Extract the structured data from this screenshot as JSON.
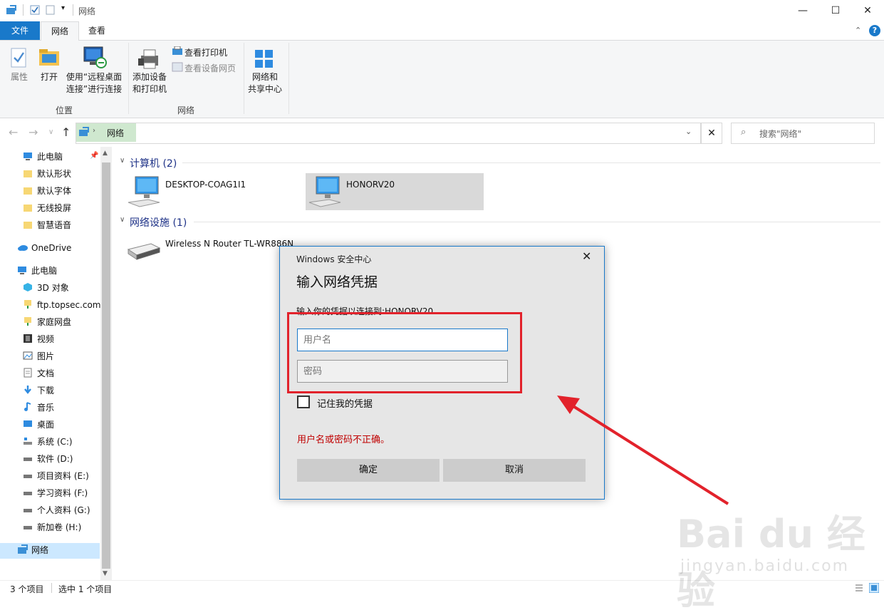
{
  "window": {
    "title": "网络",
    "minimize": "—",
    "maximize": "☐",
    "close": "✕"
  },
  "ribbon_tabs": [
    "文件",
    "网络",
    "查看"
  ],
  "ribbon": {
    "groups": [
      {
        "label": "位置",
        "buttons": [
          "属性",
          "打开",
          "使用“远程桌面\n连接”进行连接"
        ]
      },
      {
        "label": "网络",
        "buttons": [
          "添加设备\n和打印机"
        ],
        "small": [
          "查看打印机",
          "查看设备网页"
        ]
      },
      {
        "label": "",
        "buttons": [
          "网络和\n共享中心"
        ]
      }
    ],
    "help_icon": "?"
  },
  "address": {
    "crumb": "网络",
    "search_placeholder": "搜索\"网络\""
  },
  "sidebar": {
    "quick": [
      {
        "label": "此电脑",
        "icon": "pc-icon"
      },
      {
        "label": "默认形状",
        "icon": "folder-icon"
      },
      {
        "label": "默认字体",
        "icon": "folder-icon"
      },
      {
        "label": "无线投屏",
        "icon": "folder-icon"
      },
      {
        "label": "智慧语音",
        "icon": "folder-icon"
      }
    ],
    "onedrive": "OneDrive",
    "thispc": "此电脑",
    "pc_items": [
      {
        "label": "3D 对象",
        "icon": "cube-icon"
      },
      {
        "label": "ftp.topsec.com",
        "icon": "netdrive-icon"
      },
      {
        "label": "家庭网盘",
        "icon": "netdrive-icon"
      },
      {
        "label": "视频",
        "icon": "video-icon"
      },
      {
        "label": "图片",
        "icon": "picture-icon"
      },
      {
        "label": "文档",
        "icon": "document-icon"
      },
      {
        "label": "下载",
        "icon": "download-icon"
      },
      {
        "label": "音乐",
        "icon": "music-icon"
      },
      {
        "label": "桌面",
        "icon": "desktop-icon"
      },
      {
        "label": "系统 (C:)",
        "icon": "drive-icon"
      },
      {
        "label": "软件 (D:)",
        "icon": "drive-icon"
      },
      {
        "label": "项目资料 (E:)",
        "icon": "drive-icon"
      },
      {
        "label": "学习资料 (F:)",
        "icon": "drive-icon"
      },
      {
        "label": "个人资料 (G:)",
        "icon": "drive-icon"
      },
      {
        "label": "新加卷 (H:)",
        "icon": "drive-icon"
      }
    ],
    "network": "网络"
  },
  "content": {
    "computers_header": "计算机 (2)",
    "computers": [
      "DESKTOP-COAG1I1",
      "HONORV20"
    ],
    "infra_header": "网络设施 (1)",
    "infra": [
      "Wireless N Router TL-WR886N"
    ]
  },
  "status": {
    "count": "3 个项目",
    "selected": "选中 1 个项目"
  },
  "dialog": {
    "app": "Windows 安全中心",
    "title": "输入网络凭据",
    "subtitle": "输入你的凭据以连接到:HONORV20",
    "username_placeholder": "用户名",
    "password_placeholder": "密码",
    "remember": "记住我的凭据",
    "error": "用户名或密码不正确。",
    "ok": "确定",
    "cancel": "取消"
  },
  "watermark": {
    "main": "Bai du 经验",
    "sub": "jingyan.baidu.com"
  },
  "colors": {
    "accent": "#1979ca",
    "error": "#c00000",
    "annotation": "#e2222b"
  }
}
